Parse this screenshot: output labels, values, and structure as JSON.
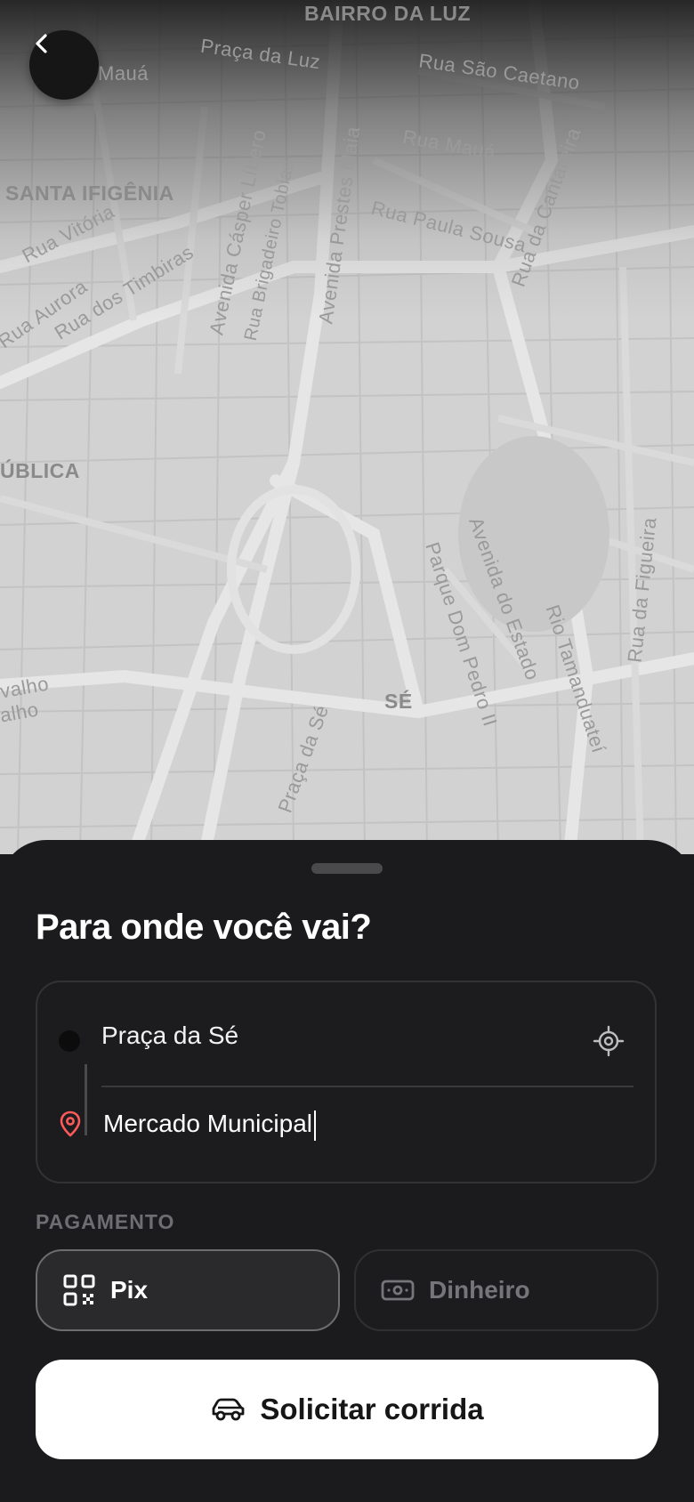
{
  "map": {
    "labels": {
      "bairro_da_luz": "BAIRRO DA LUZ",
      "maua_top": "Mauá",
      "praca_da_luz": "Praça da Luz",
      "rua_sao_caetano": "Rua São Caetano",
      "rua_maua": "Rua Mauá",
      "santa_ifigenia": "SANTA IFIGÊNIA",
      "rua_vitoria": "Rua Vitória",
      "rua_aurora": "Rua Aurora",
      "rua_dos_timbiras": "Rua dos Timbiras",
      "av_casper_libero": "Avenida Cásper Líbero",
      "rua_brig_tobias": "Rua Brigadeiro Tobias",
      "av_prestes_maia": "Avenida Prestes Maia",
      "rua_paula_sousa": "Rua Paula Sousa",
      "rua_da_cantareira": "Rua da Cantareira",
      "republica": "ÚBLICA",
      "av_do_estado": "Avenida do Estado",
      "parque_dom_pedro": "Parque Dom Pedro II",
      "rio_tamanduatei": "Rio Tamanduateí",
      "rua_da_figueira": "Rua da Figueira",
      "se": "SÉ",
      "praca_da_se": "Praça da Sé",
      "carvalho": "valho",
      "carvalho2": "alho"
    }
  },
  "header": {
    "back_icon": "chevron-left-icon"
  },
  "sheet": {
    "title": "Para onde você vai?",
    "origin": {
      "text": "Praça da Sé",
      "locate_icon": "crosshair-icon"
    },
    "destination": {
      "value": "Mercado Municipal",
      "pin_color": "#ff5a5a"
    },
    "payment": {
      "label": "PAGAMENTO",
      "options": [
        {
          "label": "Pix",
          "icon": "qr-code-icon",
          "selected": true
        },
        {
          "label": "Dinheiro",
          "icon": "cash-icon",
          "selected": false
        }
      ]
    },
    "cta": {
      "label": "Solicitar corrida",
      "icon": "car-icon"
    }
  }
}
